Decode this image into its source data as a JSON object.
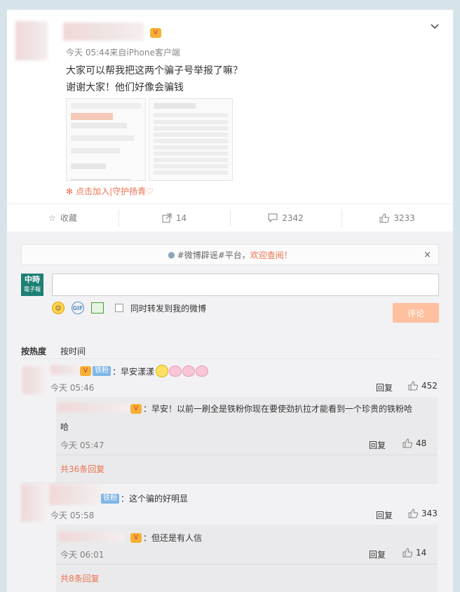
{
  "post": {
    "meta": "今天 05:44来自iPhone客户端",
    "line1": "大家可以帮我把这两个骗子号举报了嘛？",
    "line2": "谢谢大家！他们好像会骗钱",
    "join_label": "点击加入|守护扬青♡"
  },
  "actions": {
    "favorite": "收藏",
    "repost_count": "14",
    "comment_count": "2342",
    "like_count": "3233"
  },
  "notice": {
    "topic": "#微博辟谣#平台，",
    "link": "欢迎查阅！",
    "close": "×"
  },
  "composer": {
    "logo_top": "中時",
    "logo_bottom": "電子報",
    "forward_label": "同时转发到我的微博",
    "submit_label": "评论"
  },
  "sort": {
    "hot": "按热度",
    "time": "按时间"
  },
  "comments": [
    {
      "badge": "铁粉",
      "text": "：早安漾漾",
      "time": "今天 05:46",
      "reply": "回复",
      "likes": "452",
      "sub": {
        "text1": "：早安！以前一刷全是铁粉你现在要使劲扒拉才能看到一个珍贵的铁粉哈",
        "text2": "哈",
        "time": "今天 05:47",
        "reply": "回复",
        "likes": "48"
      },
      "more": "共36条回复"
    },
    {
      "badge": "铁粉",
      "text": "：这个骗的好明显",
      "time": "今天 05:58",
      "reply": "回复",
      "likes": "343",
      "sub": {
        "text1": "：但还是有人信",
        "time": "今天 06:01",
        "reply": "回复",
        "likes": "14"
      },
      "more": "共8条回复"
    }
  ],
  "colors": {
    "accent": "#eb7350",
    "submit": "#ffc09f",
    "page_bg": "#d7e3ea"
  }
}
